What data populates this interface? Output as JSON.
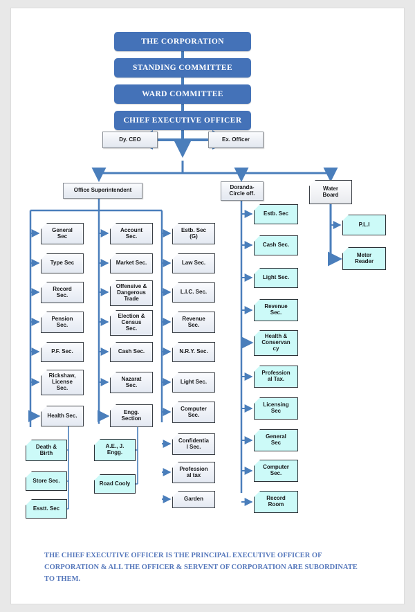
{
  "chart_data": {
    "type": "diagram",
    "title": "Municipal Corporation Organisational Chart",
    "note": "THE CHIEF EXECUTIVE OFFICER IS THE PRINCIPAL EXECUTIVE OFFICER OF CORPORATION & ALL THE OFFICER & SERVENT OF CORPORATION ARE SUBORDINATE TO THEM."
  },
  "colors": {
    "header_blue": "#4472b8",
    "connector_blue": "#4a7ebb",
    "cyan_box": "#ccfaf8",
    "grey_box": "#eef1f7",
    "note_text": "#5577bb"
  },
  "headers": [
    {
      "id": "corporation",
      "label": "THE CORPORATION"
    },
    {
      "id": "standing-committee",
      "label": "STANDING COMMITTEE"
    },
    {
      "id": "ward-committee",
      "label": "WARD COMMITTEE"
    },
    {
      "id": "chief-executive-officer",
      "label": "CHIEF EXECUTIVE OFFICER"
    }
  ],
  "officers": [
    {
      "id": "dy-ceo",
      "label": "Dy. CEO"
    },
    {
      "id": "ex-officer",
      "label": "Ex. Officer"
    }
  ],
  "branches": [
    {
      "id": "office-superintendent",
      "label": "Office Superintendent"
    },
    {
      "id": "doranda-circle-off",
      "label": "Doranda-\nCircle off."
    },
    {
      "id": "water-board",
      "label": "Water\nBoard"
    }
  ],
  "columns": {
    "col1": [
      {
        "label": "General\nSec"
      },
      {
        "label": "Type Sec"
      },
      {
        "label": "Record\nSec."
      },
      {
        "label": "Pension\nSec."
      },
      {
        "label": "P.F. Sec."
      },
      {
        "label": "Rickshaw,\nLicense\nSec."
      },
      {
        "label": "Health Sec."
      }
    ],
    "col2": [
      {
        "label": "Account\nSec."
      },
      {
        "label": "Market Sec."
      },
      {
        "label": "Offensive &\nDangerous\nTrade"
      },
      {
        "label": "Election &\nCensus\nSec."
      },
      {
        "label": "Cash Sec."
      },
      {
        "label": "Nazarat\nSec."
      },
      {
        "label": "Engg.\nSection"
      }
    ],
    "col3": [
      {
        "label": "Estb. Sec\n(G)"
      },
      {
        "label": "Law Sec."
      },
      {
        "label": "L.I.C. Sec."
      },
      {
        "label": "Revenue\nSec."
      },
      {
        "label": "N.R.Y. Sec."
      },
      {
        "label": "Light Sec."
      },
      {
        "label": "Computer\nSec."
      },
      {
        "label": "Confidentia\nl Sec."
      },
      {
        "label": "Profession\nal tax"
      },
      {
        "label": "Garden"
      }
    ],
    "doranda": [
      {
        "label": "Estb. Sec"
      },
      {
        "label": "Cash Sec."
      },
      {
        "label": "Light Sec."
      },
      {
        "label": "Revenue\nSec."
      },
      {
        "label": "Health &\nConservan\ncy"
      },
      {
        "label": "Profession\nal Tax."
      },
      {
        "label": "Licensing\nSec"
      },
      {
        "label": "General\nSec"
      },
      {
        "label": "Computer\nSec."
      },
      {
        "label": "Record\nRoom"
      }
    ],
    "water_board": [
      {
        "label": "P.L.I"
      },
      {
        "label": "Meter\nReader"
      }
    ],
    "health_sub": [
      {
        "label": "Death &\nBirth"
      },
      {
        "label": "Store Sec."
      },
      {
        "label": "Esstt. Sec"
      }
    ],
    "engg_sub": [
      {
        "label": "A.E., J.\nEngg."
      },
      {
        "label": "Road Cooly"
      }
    ]
  }
}
